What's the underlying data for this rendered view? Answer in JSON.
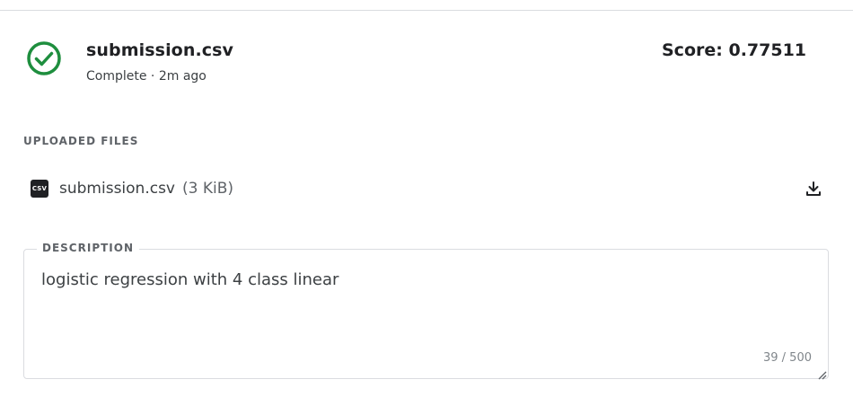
{
  "submission": {
    "filename": "submission.csv",
    "status_meta": "Complete · 2m ago",
    "score": "Score: 0.77511",
    "status_icon": "check-circle-icon",
    "status_color": "#1e8e3e"
  },
  "uploaded_files": {
    "heading": "UPLOADED FILES",
    "files": [
      {
        "icon_text": "CSV",
        "name": "submission.csv",
        "size": "(3 KiB)",
        "action_icon": "download-icon"
      }
    ]
  },
  "description": {
    "label": "DESCRIPTION",
    "value": "logistic regression with 4 class linear",
    "char_count": "39 / 500"
  }
}
